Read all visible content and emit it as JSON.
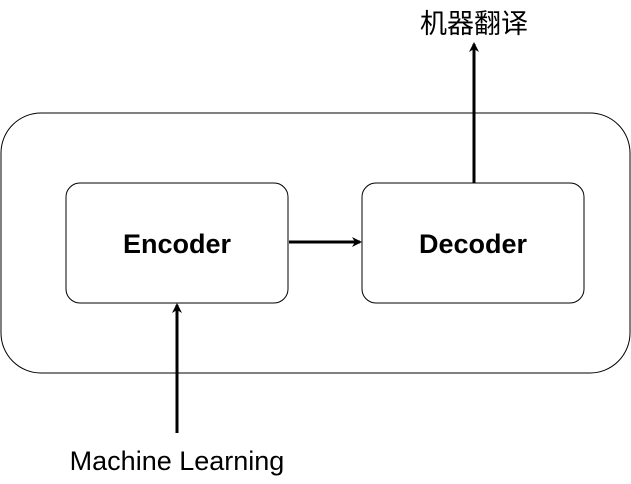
{
  "diagram": {
    "encoder": {
      "label": "Encoder"
    },
    "decoder": {
      "label": "Decoder"
    },
    "input": {
      "label": "Machine Learning"
    },
    "output": {
      "label": "机器翻译"
    },
    "colors": {
      "stroke": "#000000",
      "fill": "#ffffff"
    }
  }
}
